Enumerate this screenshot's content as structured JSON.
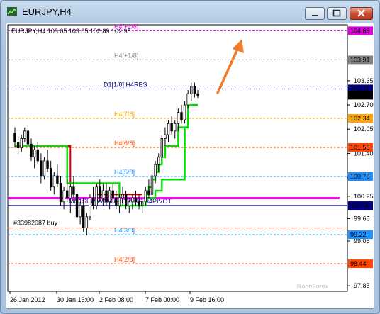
{
  "window": {
    "title": "EURJPY,H4",
    "buttons": [
      "minimize",
      "maximize",
      "close"
    ]
  },
  "chart_data": {
    "type": "candlestick",
    "symbol_info": "EURJPY,H4  103.05 103.05 102.89 102.96",
    "ylim": [
      97.7,
      104.85
    ],
    "y_ticks": [
      "103.35",
      "102.70",
      "102.05",
      "101.40",
      "100.75",
      "100.25",
      "99.65",
      "99.05",
      "97.85"
    ],
    "x_ticks": [
      "26 Jan 2012",
      "30 Jan 16:00",
      "2 Feb 08:00",
      "7 Feb 00:00",
      "9 Feb 16:00"
    ],
    "murrey_levels": [
      {
        "label": "H4[+2/8]",
        "price": 104.69,
        "price_label": "104.69",
        "color": "#e000e0"
      },
      {
        "label": "H4[+1/8]",
        "price": 103.91,
        "price_label": "103.91",
        "color": "#808080"
      },
      {
        "label": "D1[1/8] H4RES",
        "price": 103.13,
        "price_label": "103.13",
        "color": "#000080"
      },
      {
        "label": "H4[7/8]",
        "price": 102.34,
        "price_label": "102.34",
        "color": "#ffa500"
      },
      {
        "label": "H4[6/8]",
        "price": 101.56,
        "price_label": "101.56",
        "color": "#ff4500"
      },
      {
        "label": "H4[5/8]",
        "price": 100.78,
        "price_label": "100.78",
        "color": "#1e90ff"
      },
      {
        "label": "MN1SUP W1SUP D1SUP H4PIVOT",
        "price": 100.0,
        "price_label": "100.00",
        "color": "#000080"
      },
      {
        "label": "H4[3/8]",
        "price": 99.22,
        "price_label": "99.22",
        "color": "#1e90ff"
      },
      {
        "label": "H4[2/8]",
        "price": 98.44,
        "price_label": "98.44",
        "color": "#ff4500"
      }
    ],
    "current_price": "102.96",
    "order": {
      "label": "#33982087 buy",
      "price": 99.4
    },
    "magenta_level": 100.2,
    "candles": [
      [
        101.95,
        102.1,
        101.55,
        101.7
      ],
      [
        101.7,
        101.85,
        101.4,
        101.55
      ],
      [
        101.55,
        101.9,
        101.45,
        101.8
      ],
      [
        101.8,
        102.1,
        101.7,
        102.0
      ],
      [
        102.0,
        102.15,
        101.6,
        101.65
      ],
      [
        101.65,
        101.8,
        101.2,
        101.3
      ],
      [
        101.3,
        101.6,
        101.0,
        101.5
      ],
      [
        101.5,
        101.7,
        101.1,
        101.2
      ],
      [
        101.2,
        101.4,
        100.6,
        100.8
      ],
      [
        100.8,
        101.3,
        100.7,
        101.2
      ],
      [
        101.2,
        101.5,
        100.9,
        101.0
      ],
      [
        101.0,
        101.2,
        100.4,
        100.5
      ],
      [
        100.5,
        100.9,
        100.3,
        100.8
      ],
      [
        100.8,
        101.1,
        100.5,
        100.6
      ],
      [
        100.6,
        100.8,
        100.0,
        100.1
      ],
      [
        100.1,
        100.5,
        99.9,
        100.4
      ],
      [
        100.4,
        100.7,
        100.1,
        100.2
      ],
      [
        100.2,
        100.6,
        99.8,
        100.5
      ],
      [
        100.5,
        100.8,
        100.2,
        100.3
      ],
      [
        100.3,
        100.4,
        99.6,
        99.7
      ],
      [
        99.7,
        100.1,
        99.5,
        100.0
      ],
      [
        100.0,
        100.2,
        99.3,
        99.4
      ],
      [
        99.4,
        99.8,
        99.2,
        99.7
      ],
      [
        99.7,
        100.3,
        99.6,
        100.2
      ],
      [
        100.2,
        100.5,
        99.9,
        100.0
      ],
      [
        100.0,
        100.6,
        99.9,
        100.5
      ],
      [
        100.5,
        100.7,
        100.1,
        100.2
      ],
      [
        100.2,
        100.6,
        100.0,
        100.4
      ],
      [
        100.4,
        100.6,
        100.0,
        100.1
      ],
      [
        100.1,
        100.5,
        99.9,
        100.4
      ],
      [
        100.4,
        100.6,
        100.1,
        100.2
      ],
      [
        100.2,
        100.4,
        99.9,
        100.0
      ],
      [
        100.0,
        100.3,
        99.8,
        100.2
      ],
      [
        100.2,
        100.5,
        100.0,
        100.3
      ],
      [
        100.3,
        100.4,
        99.9,
        100.0
      ],
      [
        100.0,
        100.2,
        99.8,
        100.1
      ],
      [
        100.1,
        100.3,
        99.9,
        100.2
      ],
      [
        100.2,
        100.4,
        100.0,
        100.1
      ],
      [
        100.1,
        100.3,
        99.9,
        100.0
      ],
      [
        100.0,
        100.2,
        99.8,
        100.1
      ],
      [
        100.1,
        100.5,
        100.0,
        100.4
      ],
      [
        100.4,
        100.7,
        100.2,
        100.3
      ],
      [
        100.3,
        100.9,
        100.2,
        100.8
      ],
      [
        100.8,
        101.2,
        100.6,
        101.1
      ],
      [
        101.1,
        101.4,
        100.9,
        101.3
      ],
      [
        101.3,
        101.9,
        101.2,
        101.8
      ],
      [
        101.8,
        102.1,
        101.6,
        101.9
      ],
      [
        101.9,
        102.3,
        101.7,
        102.2
      ],
      [
        102.2,
        102.4,
        101.9,
        102.0
      ],
      [
        102.0,
        102.3,
        101.8,
        102.2
      ],
      [
        102.2,
        102.6,
        102.0,
        102.5
      ],
      [
        102.5,
        102.7,
        102.2,
        102.3
      ],
      [
        102.3,
        102.8,
        102.2,
        102.7
      ],
      [
        102.7,
        103.1,
        102.6,
        103.0
      ],
      [
        103.0,
        103.3,
        102.8,
        103.2
      ],
      [
        103.2,
        103.3,
        102.9,
        103.0
      ],
      [
        103.0,
        103.1,
        102.89,
        102.96
      ]
    ],
    "support_line": [
      101.6,
      101.6,
      101.6,
      101.6,
      101.6,
      101.6,
      101.6,
      101.6,
      101.6,
      101.6,
      101.6,
      101.6,
      101.6,
      101.6,
      101.6,
      101.6,
      100.6,
      100.6,
      100.6,
      100.6,
      100.6,
      100.6,
      100.6,
      100.6,
      100.6,
      100.6,
      100.6,
      100.6,
      100.6,
      100.6,
      100.6,
      100.6,
      100.0,
      100.0,
      100.0,
      100.0,
      100.0,
      100.0,
      100.0,
      100.0,
      100.3,
      100.5,
      100.7,
      100.9,
      101.1,
      101.3,
      101.6,
      101.6,
      101.6,
      101.6,
      102.1,
      102.1,
      102.1,
      102.7,
      102.7,
      102.7,
      102.7
    ],
    "upper_line": [
      null,
      null,
      null,
      null,
      null,
      null,
      null,
      null,
      null,
      null,
      101.6,
      101.6,
      101.6,
      101.6,
      101.6,
      101.6,
      101.6,
      100.6,
      100.6,
      100.6,
      100.6,
      100.6,
      100.6,
      100.6,
      100.6,
      100.3,
      100.3,
      100.3,
      100.3,
      100.3,
      100.3,
      100.3,
      100.3,
      100.3,
      100.3,
      100.3,
      100.3,
      100.3,
      100.3,
      100.3,
      null,
      null,
      null,
      null,
      null,
      null,
      null,
      null,
      null,
      null,
      null,
      null,
      null,
      null,
      null,
      null,
      null
    ],
    "lower_line": [
      null,
      null,
      null,
      null,
      null,
      null,
      null,
      null,
      null,
      null,
      null,
      null,
      null,
      null,
      null,
      null,
      null,
      null,
      null,
      null,
      null,
      null,
      null,
      null,
      null,
      null,
      null,
      null,
      null,
      null,
      null,
      null,
      null,
      null,
      null,
      null,
      null,
      null,
      null,
      null,
      100.2,
      100.2,
      100.2,
      100.4,
      100.4,
      100.7,
      100.7,
      100.7,
      100.7,
      100.7,
      100.7,
      100.7,
      102.1,
      102.1,
      null,
      null,
      null
    ],
    "watermark": "RoboForex"
  }
}
